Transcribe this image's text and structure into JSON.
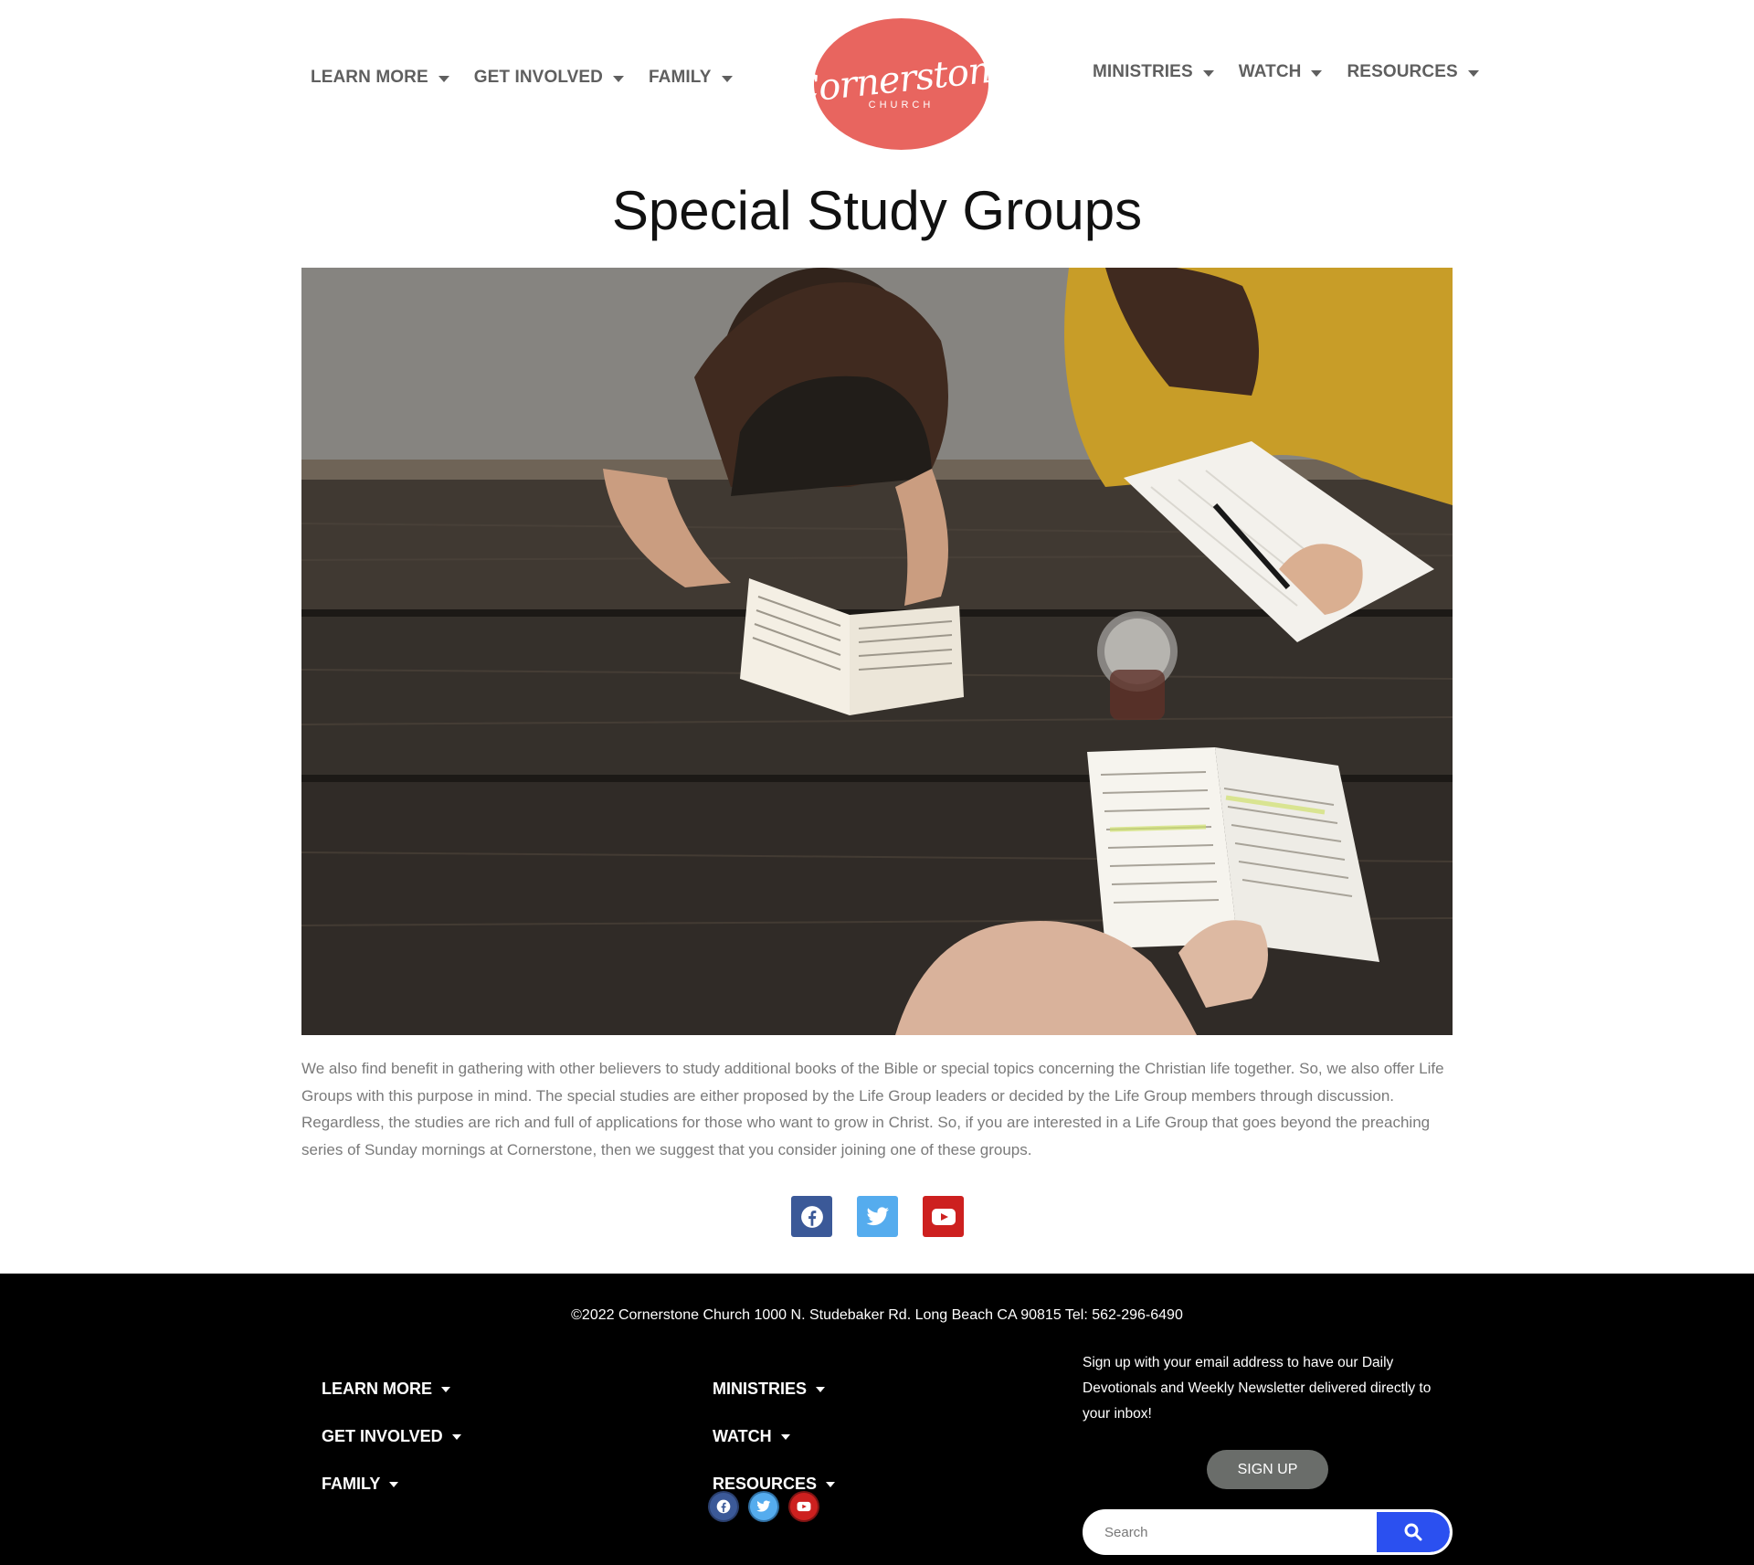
{
  "header": {
    "nav_left": [
      {
        "label": "LEARN MORE"
      },
      {
        "label": "GET INVOLVED"
      },
      {
        "label": "FAMILY"
      }
    ],
    "nav_right": [
      {
        "label": "MINISTRIES"
      },
      {
        "label": "WATCH"
      },
      {
        "label": "RESOURCES"
      }
    ],
    "logo": {
      "script": "Cornerstone",
      "sub": "CHURCH",
      "color": "#e8655f"
    }
  },
  "main": {
    "title": "Special Study Groups",
    "body": "We also find benefit in gathering with other believers to study additional books of the Bible or special topics concerning the Christian life together. So, we also offer Life Groups with this purpose in mind. The special studies are either proposed by the Life Group leaders or decided by the Life Group members through discussion. Regardless, the studies are rich and full of applications for those who want to grow in Christ. So, if you are interested in a Life Group that goes beyond the preaching series of Sunday mornings at Cornerstone, then we suggest that you consider joining one of these groups.",
    "social": [
      {
        "icon": "facebook-icon",
        "color": "#3b5998"
      },
      {
        "icon": "twitter-icon",
        "color": "#1da1f2"
      },
      {
        "icon": "youtube-icon",
        "color": "#cd201f"
      }
    ]
  },
  "footer": {
    "copyright": "©2022 Cornerstone Church 1000 N. Studebaker Rd. Long Beach CA 90815 Tel: 562-296-6490",
    "nav_left": [
      {
        "label": "LEARN MORE"
      },
      {
        "label": "GET INVOLVED"
      },
      {
        "label": "FAMILY"
      }
    ],
    "nav_mid": [
      {
        "label": "MINISTRIES"
      },
      {
        "label": "WATCH"
      },
      {
        "label": "RESOURCES"
      }
    ],
    "signup_text": "Sign up with your email address to have our Daily Devotionals and Weekly Newsletter delivered directly to your inbox!",
    "signup_label": "SIGN UP",
    "search_placeholder": "Search",
    "search_button_color": "#2b50f0"
  }
}
